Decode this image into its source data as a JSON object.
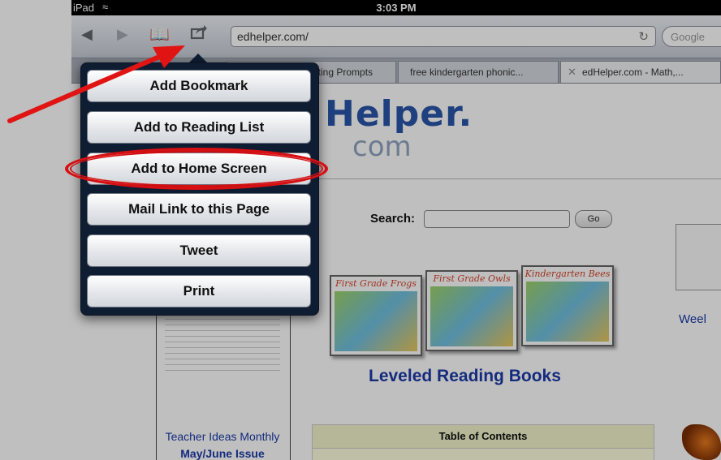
{
  "status_bar": {
    "device": "iPad",
    "time": "3:03 PM"
  },
  "toolbar": {
    "back_icon": "back-arrow-icon",
    "forward_icon": "forward-arrow-icon",
    "bookmarks_icon": "bookmarks-book-icon",
    "share_icon": "share-action-icon",
    "url": "edhelper.com/",
    "reload_icon": "reload-icon",
    "search_placeholder": "Google"
  },
  "tabs": [
    {
      "label": "iting Prompts"
    },
    {
      "label": "free kindergarten phonic..."
    },
    {
      "label": "edHelper.com - Math,..."
    }
  ],
  "share_menu": {
    "items": [
      {
        "label": "Add Bookmark"
      },
      {
        "label": "Add to Reading List"
      },
      {
        "label": "Add to Home Screen"
      },
      {
        "label": "Mail Link to this Page"
      },
      {
        "label": "Tweet"
      },
      {
        "label": "Print"
      }
    ],
    "highlighted_item": "Add to Home Screen",
    "annotation_color": "#d50f12"
  },
  "page": {
    "logo_top": "Helper.",
    "logo_bottom": "com",
    "search_label": "Search:",
    "go_label": "Go",
    "books": [
      {
        "title": "First Grade Frogs"
      },
      {
        "title": "First Grade Owls"
      },
      {
        "title": "Kindergarten Bees"
      }
    ],
    "books_heading": "Leveled Reading Books",
    "teacher_title": "Teacher Ideas Monthly",
    "teacher_issue": "May/June Issue",
    "toc_heading": "Table of Contents",
    "weekly_label": "Weel",
    "link_color": "#1c3aa9"
  }
}
